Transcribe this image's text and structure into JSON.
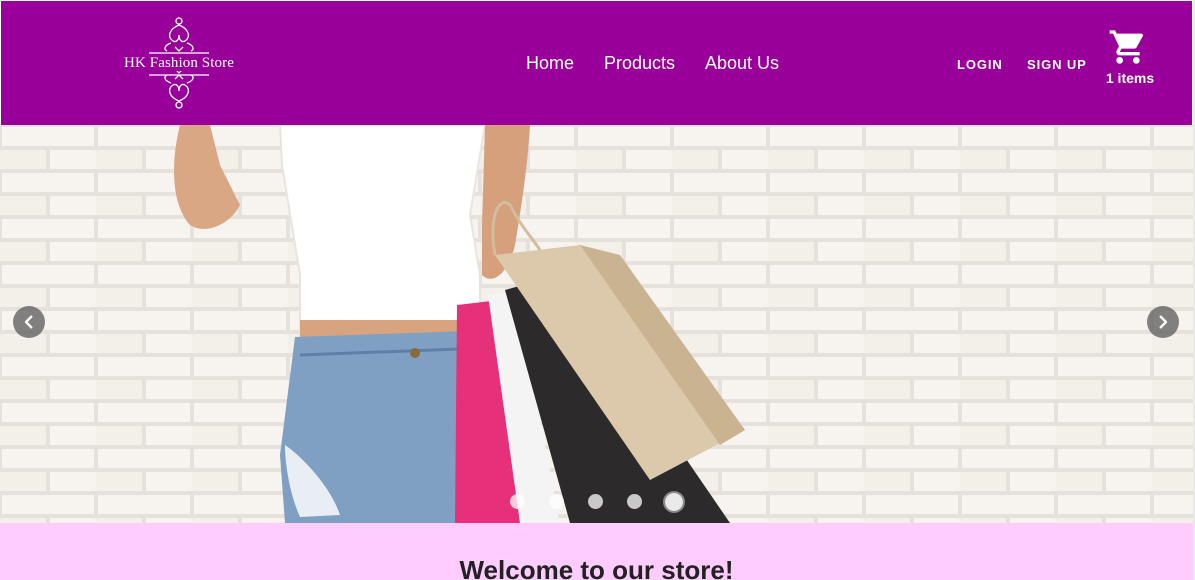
{
  "header": {
    "logo_text": "HK Fashion Store",
    "nav": [
      {
        "label": "Home"
      },
      {
        "label": "Products"
      },
      {
        "label": "About Us"
      }
    ],
    "login_label": "LOGIN",
    "signup_label": "SIGN UP",
    "cart_icon": "shopping-cart-icon",
    "cart_count_label": "1 items"
  },
  "carousel": {
    "slide_count": 5,
    "active_slide": 5,
    "prev_icon": "chevron-left-icon",
    "next_icon": "chevron-right-icon"
  },
  "welcome": {
    "title": "Welcome to our store!"
  },
  "colors": {
    "header_bg": "#990099",
    "welcome_bg": "#ffccff",
    "text_on_header": "#ffffff"
  }
}
